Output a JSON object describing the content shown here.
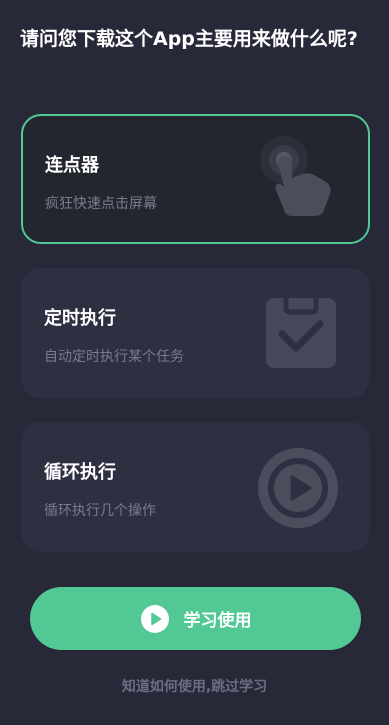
{
  "question": "请问您下载这个App主要用来做什么呢?",
  "options": [
    {
      "title": "连点器",
      "description": "疯狂快速点击屏幕",
      "icon": "tap-hand-icon",
      "selected": true
    },
    {
      "title": "定时执行",
      "description": "自动定时执行某个任务",
      "icon": "clipboard-check-icon",
      "selected": false
    },
    {
      "title": "循环执行",
      "description": "循环执行几个操作",
      "icon": "play-circle-icon",
      "selected": false
    }
  ],
  "cta": {
    "label": "学习使用",
    "icon": "play-icon"
  },
  "skip_label": "知道如何使用,跳过学习",
  "colors": {
    "background": "#272838",
    "card": "#2e2f41",
    "accent": "#52c995",
    "muted_text": "#7a7b8e"
  }
}
